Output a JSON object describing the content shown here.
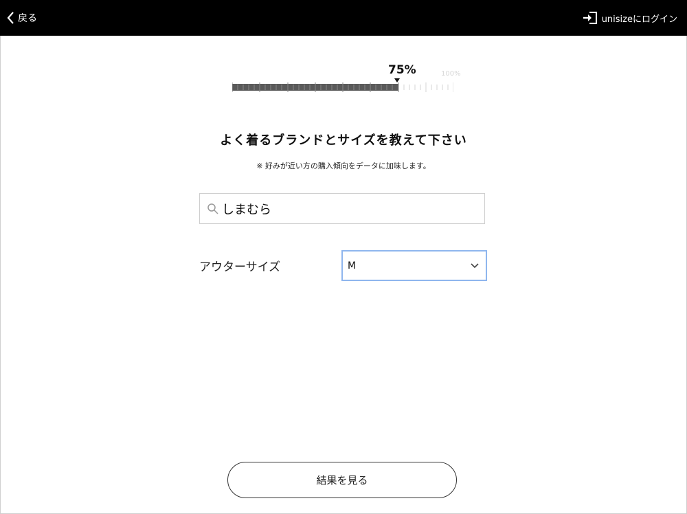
{
  "header": {
    "back_label": "戻る",
    "login_label": "unisizeにログイン",
    "back_icon": "chevron-left-icon",
    "login_icon": "login-icon"
  },
  "progress": {
    "percent": 75,
    "percent_label": "75%",
    "max_label": "100%"
  },
  "main": {
    "title": "よく着るブランドとサイズを教えて下さい",
    "note": "※ 好みが近い方の購入傾向をデータに加味します。",
    "search": {
      "value": "しまむら",
      "icon": "search-icon"
    },
    "size": {
      "label": "アウターサイズ",
      "selected": "M",
      "icon": "chevron-down-icon"
    },
    "result_button": "結果を見る"
  },
  "colors": {
    "header_bg": "#000000",
    "select_border": "#8fb6ee",
    "progress_fill": "#5a5a5a"
  }
}
